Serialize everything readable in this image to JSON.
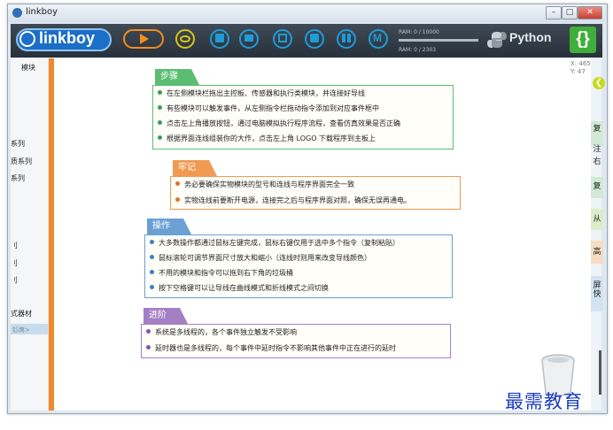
{
  "window": {
    "title": "linkboy"
  },
  "toolbar": {
    "logo_text": "linkboy",
    "ram_top": "RAM: 0 / 10000",
    "ram_bottom": "RAM: 0 / 2303",
    "python_label": "Python",
    "code_button": "{}"
  },
  "sidebar": {
    "title": "模块",
    "items": [
      "系列",
      "质系列",
      "系列",
      "刂",
      "刂",
      "刂",
      "式器材"
    ],
    "more": "钐席>"
  },
  "canvas": {
    "coord_x": "X: 465",
    "coord_y": "Y: 47"
  },
  "right_panel": {
    "tabs": [
      "复",
      "注",
      "右",
      "复",
      "从",
      "高",
      "屏",
      "快"
    ]
  },
  "sections": [
    {
      "title": "步骤",
      "color": "#5bbd72",
      "lines": [
        "在左侧模块栏拖出主控板、传感器和执行类模块，并连接好导线",
        "有些模块可以触发事件，从左侧指令栏拖动指令添加到对应事件框中",
        "点击左上角播放按钮，通过电脑模拟执行程序流程，查看仿真效果是否正确",
        "根据界面连线组装你的大作，点击左上角 LOGO 下载程序到主板上"
      ]
    },
    {
      "title": "牢记",
      "color": "#f09a52",
      "lines": [
        "务必要确保实物模块的型号和连线与程序界面完全一致",
        "实物连线前要断开电源，连接完之后与程序界面对照，确保无误再通电。"
      ]
    },
    {
      "title": "操作",
      "color": "#6aa0d4",
      "lines": [
        "大多数操作都通过鼠标左键完成，鼠标右键仅用于选中多个指令（复制粘贴）",
        "鼠标滚轮可调节界面尺寸放大和缩小（连线时则用来改变导线颜色）",
        "不用的模块和指令可以拖到右下角的垃圾桶",
        "按下空格键可以让导线在曲线模式和折线模式之间切换"
      ]
    },
    {
      "title": "进阶",
      "color": "#a57fc4",
      "lines": [
        "系统是多线程的，各个事件独立触发不受影响",
        "延时器也是多线程的，每个事件中延时指令不影响其他事件中正在进行的延时"
      ]
    }
  ],
  "watermark": "最需教育"
}
